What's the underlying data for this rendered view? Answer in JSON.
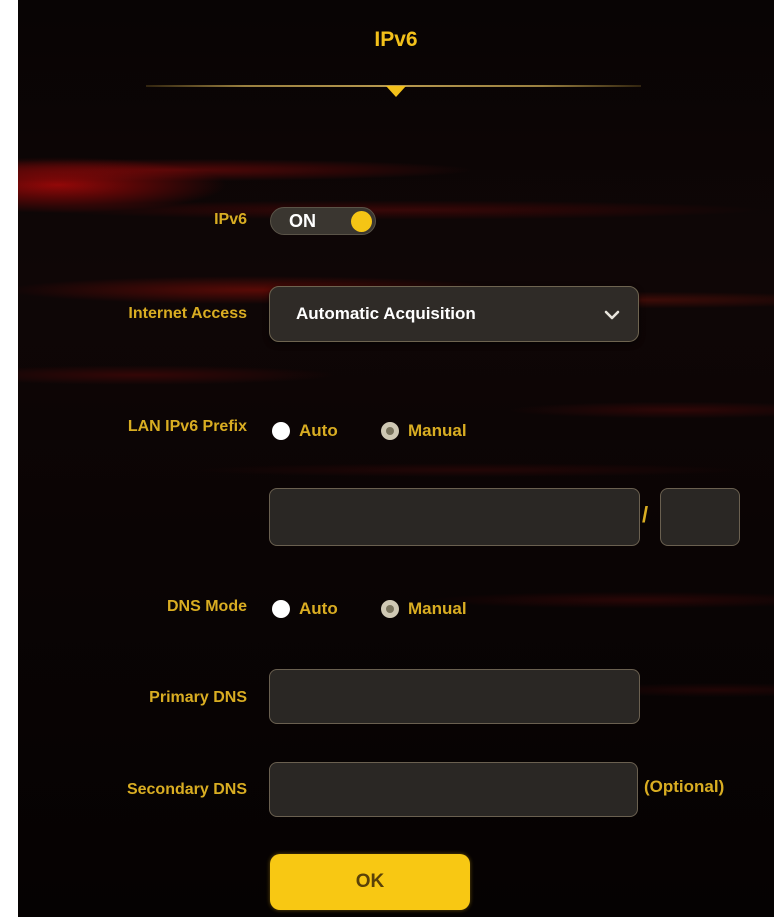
{
  "header": {
    "title": "IPv6"
  },
  "ipv6": {
    "label": "IPv6",
    "toggle_state": "ON"
  },
  "internet_access": {
    "label": "Internet Access",
    "value": "Automatic Acquisition"
  },
  "lan_prefix": {
    "label": "LAN IPv6 Prefix",
    "options": [
      {
        "label": "Auto",
        "selected": false
      },
      {
        "label": "Manual",
        "selected": true
      }
    ],
    "prefix_value": "",
    "length_value": "",
    "separator": "/"
  },
  "dns_mode": {
    "label": "DNS Mode",
    "options": [
      {
        "label": "Auto",
        "selected": false
      },
      {
        "label": "Manual",
        "selected": true
      }
    ]
  },
  "primary_dns": {
    "label": "Primary DNS",
    "value": ""
  },
  "secondary_dns": {
    "label": "Secondary DNS",
    "value": "",
    "hint": "(Optional)"
  },
  "actions": {
    "ok_label": "OK"
  },
  "colors": {
    "accent": "#f2c01a",
    "label": "#d9ad22",
    "field_bg": "#2a2724"
  }
}
